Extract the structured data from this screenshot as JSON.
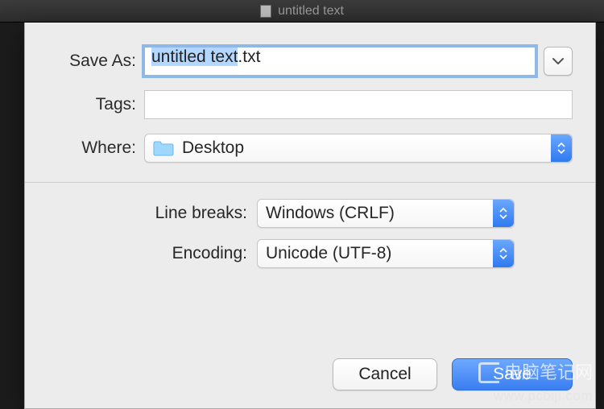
{
  "window": {
    "title": "untitled text"
  },
  "labels": {
    "save_as": "Save As:",
    "tags": "Tags:",
    "where": "Where:",
    "line_breaks": "Line breaks:",
    "encoding": "Encoding:"
  },
  "fields": {
    "filename_base": "untitled text",
    "filename_ext": ".txt",
    "tags_value": "",
    "where_value": "Desktop",
    "line_breaks_value": "Windows (CRLF)",
    "encoding_value": "Unicode (UTF-8)"
  },
  "buttons": {
    "cancel": "Cancel",
    "save": "Save"
  },
  "watermark": {
    "text": "电脑笔记网",
    "url": "www.pcbiji.com"
  }
}
